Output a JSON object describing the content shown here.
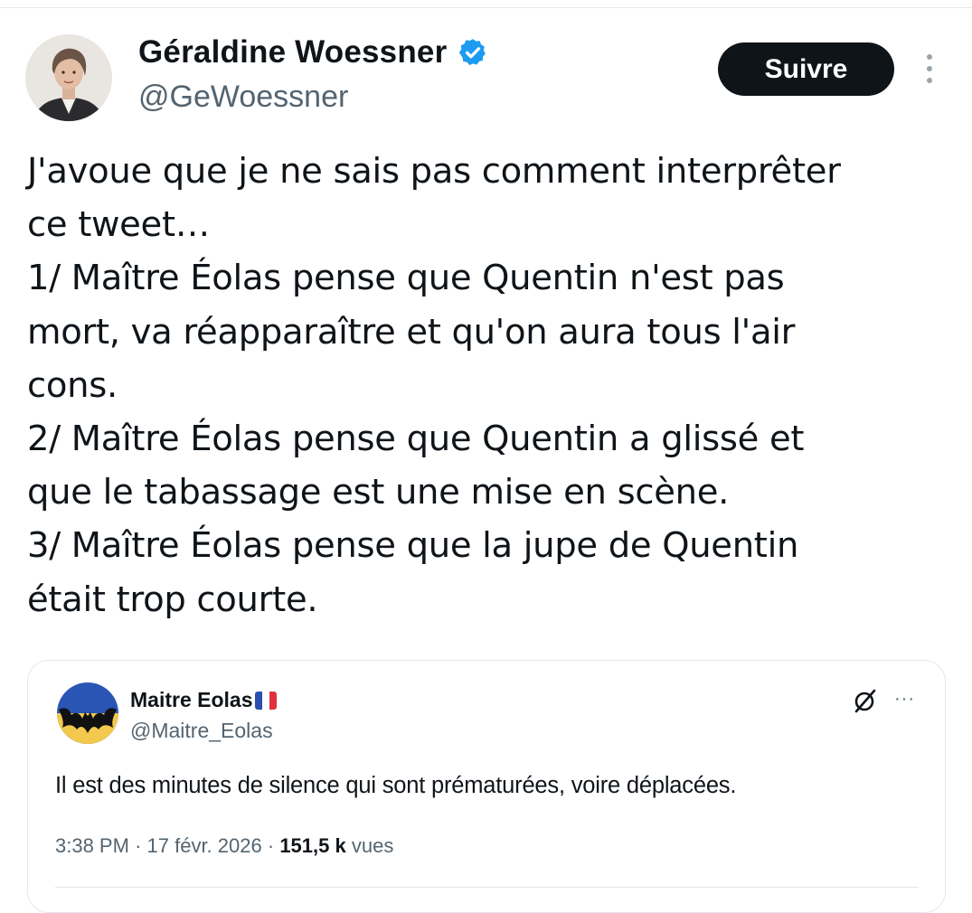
{
  "author": {
    "name": "Géraldine Woessner",
    "handle": "@GeWoessner",
    "verified_color": "#1d9bf0"
  },
  "follow_label": "Suivre",
  "tweet_lines": [
    "J'avoue que je ne sais pas comment interprêter",
    "ce tweet…",
    "1/ Maître Éolas pense que Quentin n'est pas",
    "mort, va réapparaître et qu'on aura tous l'air",
    "cons.",
    "2/ Maître Éolas pense que Quentin a glissé et",
    "que le tabassage est une mise en scène.",
    "3/ Maître Éolas pense que la jupe de Quentin",
    "était trop courte."
  ],
  "quoted": {
    "name": "Maitre Eolas",
    "flag": "french-flag-icon",
    "handle": "@Maitre_Eolas",
    "more_label": "···",
    "text": "Il est des minutes de silence qui sont prématurées, voire déplacées.",
    "time": "3:38 PM",
    "separator": "·",
    "date": "17 févr. 2026",
    "views_count": "151,5 k",
    "views_label": "vues"
  },
  "colors": {
    "text": "#0f1419",
    "secondary": "#536471",
    "follow_bg": "#0f1419",
    "border": "#e1e8ed",
    "eolas_blue": "#2a55b5",
    "eolas_yellow": "#f2c94c"
  }
}
